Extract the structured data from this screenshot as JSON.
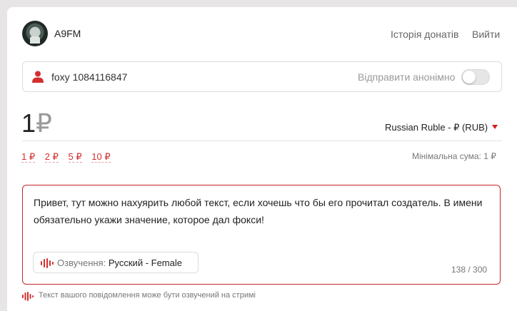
{
  "header": {
    "username": "A9FM",
    "history_link": "Історія донатів",
    "logout_link": "Вийти"
  },
  "sender": {
    "name_value": "foxy 1084116847",
    "anonymous_label": "Відправити анонімно",
    "anonymous_enabled": false
  },
  "amount": {
    "value": "1",
    "symbol": "₽",
    "currency": "Russian Ruble - ₽ (RUB)",
    "presets": [
      "1 ₽",
      "2 ₽",
      "5 ₽",
      "10 ₽"
    ],
    "min_label": "Мінімальна сума: 1 ₽"
  },
  "message": {
    "text": "Привет, тут можно нахуярить любой текст, если хочешь что бы его прочитал создатель. В имени обязательно укажи значение, которое дал фокси!",
    "voice_label": "Озвучення:",
    "voice_value": "Русский - Female",
    "counter": "138 / 300"
  },
  "hint": {
    "text": "Текст вашого повідомлення може бути озвучений на стримі"
  },
  "colors": {
    "accent": "#d32f2f",
    "border_error": "#c62828",
    "muted": "#777777"
  },
  "icons": [
    "avatar",
    "person-icon",
    "soundwave-icon",
    "caret-down-icon"
  ]
}
